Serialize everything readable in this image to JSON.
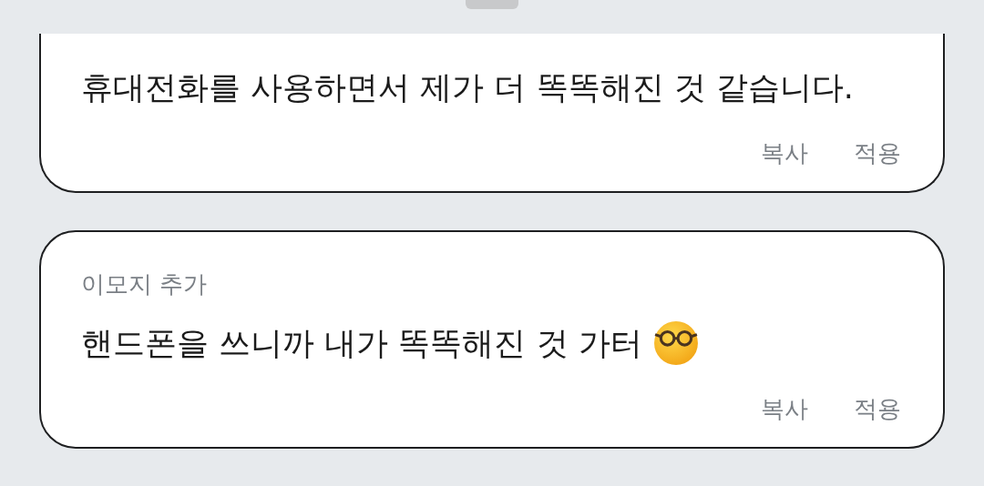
{
  "cards": [
    {
      "clipped_top": true,
      "text": "휴대전화를 사용하면서 제가 더 똑똑해진 것 같습니다.",
      "emoji": false,
      "actions": [
        "복사",
        "적용"
      ]
    },
    {
      "clipped_top": false,
      "label": "이모지 추가",
      "text": "핸드폰을 쓰니까 내가 똑똑해진 것 가터",
      "emoji": true,
      "actions": [
        "복사",
        "적용"
      ]
    }
  ]
}
